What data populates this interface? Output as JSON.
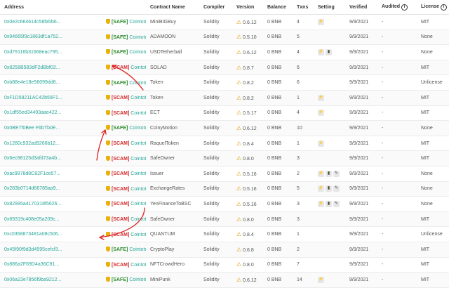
{
  "headers": {
    "address": "Address",
    "contract_name": "Contract Name",
    "compiler": "Compiler",
    "version": "Version",
    "balance": "Balance",
    "txns": "Txns",
    "setting": "Setting",
    "verified": "Verified",
    "audited": "Audited",
    "license": "License"
  },
  "rows": [
    {
      "address": "0x0e2c664614c58fa5b6...",
      "tag": "[SAFE]",
      "source": "Cointotu",
      "name": "MiniBIGBuy",
      "compiler": "Solidity",
      "version": "0.6.12",
      "balance": "0 BNB",
      "txns": "4",
      "settings": [
        "flash"
      ],
      "verified": "9/9/2021",
      "audited": "-",
      "license": "MIT"
    },
    {
      "address": "0x94665f3c1863df1a752...",
      "tag": "[SAFE]",
      "source": "Cointotu",
      "name": "ADAMOON",
      "compiler": "Solidity",
      "version": "0.5.10",
      "balance": "0 BNB",
      "txns": "5",
      "settings": [],
      "verified": "9/9/2021",
      "audited": "-",
      "license": "None"
    },
    {
      "address": "0xd79116b31668eac795...",
      "tag": "[SAFE]",
      "source": "Cointotu",
      "name": "USDTetherball",
      "compiler": "Solidity",
      "version": "0.6.12",
      "balance": "0 BNB",
      "txns": "4",
      "settings": [
        "flash",
        "chart"
      ],
      "verified": "9/9/2021",
      "audited": "-",
      "license": "None"
    },
    {
      "address": "0x8258B583dF2dBbf03...",
      "tag": "[SCAM]",
      "source": "Cointotu",
      "name": "SOLAD",
      "compiler": "Solidity",
      "version": "0.8.7",
      "balance": "0 BNB",
      "txns": "6",
      "settings": [],
      "verified": "9/9/2021",
      "audited": "-",
      "license": "MIT"
    },
    {
      "address": "0xb88e4e18e56099dd8...",
      "tag": "[SAFE]",
      "source": "Cointotu",
      "name": "Token",
      "compiler": "Solidity",
      "version": "0.8.2",
      "balance": "0 BNB",
      "txns": "6",
      "settings": [],
      "verified": "9/9/2021",
      "audited": "-",
      "license": "Unlicense"
    },
    {
      "address": "0xF1D58211AC42b55F1...",
      "tag": "[SCAM]",
      "source": "Cointotu",
      "name": "Token",
      "compiler": "Solidity",
      "version": "0.8.2",
      "balance": "0 BNB",
      "txns": "1",
      "settings": [
        "flash"
      ],
      "verified": "9/9/2021",
      "audited": "-",
      "license": "MIT"
    },
    {
      "address": "0x1df55ed34493aae422...",
      "tag": "[SCAM]",
      "source": "Cointotu",
      "name": "ECT",
      "compiler": "Solidity",
      "version": "0.5.17",
      "balance": "0 BNB",
      "txns": "4",
      "settings": [
        "flash"
      ],
      "verified": "9/9/2021",
      "audited": "-",
      "license": "MIT"
    },
    {
      "address": "0x0BE7f0Bee F6bTb0E...",
      "tag": "[SAFE]",
      "source": "Cointotu",
      "name": "CoinyMotion",
      "compiler": "Solidity",
      "version": "0.6.12",
      "balance": "0 BNB",
      "txns": "10",
      "settings": [],
      "verified": "9/9/2021",
      "audited": "-",
      "license": "None"
    },
    {
      "address": "0x1280c932ad9266b12...",
      "tag": "[SCAM]",
      "source": "Cointotu",
      "name": "RaquelToken",
      "compiler": "Solidity",
      "version": "0.8.4",
      "balance": "0 BNB",
      "txns": "1",
      "settings": [
        "flash"
      ],
      "verified": "9/9/2021",
      "audited": "-",
      "license": "MIT"
    },
    {
      "address": "0x6ec98125d3afd73a4b...",
      "tag": "[SCAM]",
      "source": "Cointotu",
      "name": "SafeOwner",
      "compiler": "Solidity",
      "version": "0.8.0",
      "balance": "0 BNB",
      "txns": "3",
      "settings": [],
      "verified": "9/9/2021",
      "audited": "-",
      "license": "MIT"
    },
    {
      "address": "0xac9978d8C82F1ce57...",
      "tag": "[SCAM]",
      "source": "Cointotu",
      "name": "Issuer",
      "compiler": "Solidity",
      "version": "0.5.16",
      "balance": "0 BNB",
      "txns": "2",
      "settings": [
        "flash",
        "chart",
        "wrench"
      ],
      "verified": "9/9/2021",
      "audited": "-",
      "license": "None"
    },
    {
      "address": "0x283b0714d66785aa9...",
      "tag": "[SCAM]",
      "source": "Cointotu",
      "name": "ExchangeRates",
      "compiler": "Solidity",
      "version": "0.5.16",
      "balance": "0 BNB",
      "txns": "5",
      "settings": [
        "flash",
        "chart",
        "wrench"
      ],
      "verified": "9/9/2021",
      "audited": "-",
      "license": "None"
    },
    {
      "address": "0x82995a4170318f5626...",
      "tag": "[SCAM]",
      "source": "Cointotu",
      "name": "YenFinanceToBSC",
      "compiler": "Solidity",
      "version": "0.5.16",
      "balance": "0 BNB",
      "txns": "3",
      "settings": [
        "flash",
        "chart",
        "wrench"
      ],
      "verified": "9/9/2021",
      "audited": "-",
      "license": "None"
    },
    {
      "address": "0x69319c408e05a209c...",
      "tag": "[SCAM]",
      "source": "Cointotu",
      "name": "SafeOwner",
      "compiler": "Solidity",
      "version": "0.8.0",
      "balance": "0 BNB",
      "txns": "3",
      "settings": [],
      "verified": "9/9/2021",
      "audited": "-",
      "license": "MIT"
    },
    {
      "address": "0xc0368873481a08c506...",
      "tag": "[SCAM]",
      "source": "Cointotu",
      "name": "QUANTUM",
      "compiler": "Solidity",
      "version": "0.8.4",
      "balance": "0 BNB",
      "txns": "1",
      "settings": [],
      "verified": "9/9/2021",
      "audited": "-",
      "license": "Unlicense"
    },
    {
      "address": "0x45f90f9d3d4595cefcf3...",
      "tag": "[SAFE]",
      "source": "Cointotu",
      "name": "CryptoPlay",
      "compiler": "Solidity",
      "version": "0.6.8",
      "balance": "0 BNB",
      "txns": "2",
      "settings": [],
      "verified": "9/9/2021",
      "audited": "-",
      "license": "MIT"
    },
    {
      "address": "0x886a2F69D4a36C81...",
      "tag": "[SCAM]",
      "source": "Cointotu",
      "name": "NFTCrowdHero",
      "compiler": "Solidity",
      "version": "0.8.0",
      "balance": "0 BNB",
      "txns": "7",
      "settings": [],
      "verified": "9/9/2021",
      "audited": "-",
      "license": "MIT"
    },
    {
      "address": "0x06a22e7856f9ba9212...",
      "tag": "[SAFE]",
      "source": "Cointotu",
      "name": "MiniPunk",
      "compiler": "Solidity",
      "version": "0.6.12",
      "balance": "0 BNB",
      "txns": "14",
      "settings": [
        "flash"
      ],
      "verified": "9/9/2021",
      "audited": "-",
      "license": "MIT"
    }
  ],
  "icons": {
    "warning": "⚠",
    "shield": "shield-icon",
    "info": "i",
    "flash": "⚡",
    "chart": "▮",
    "wrench": "✎"
  },
  "colors": {
    "safe": "#2e8b2e",
    "scam": "#d32a2a",
    "link": "#27a79a",
    "annotation": "#e02020"
  }
}
